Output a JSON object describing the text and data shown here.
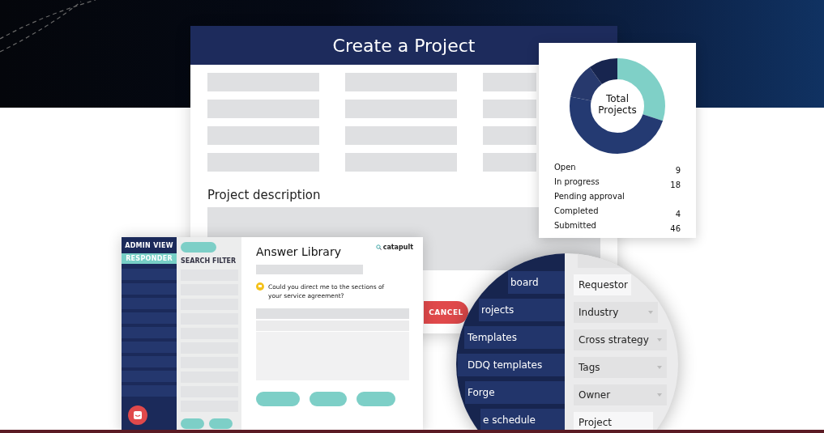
{
  "create_project": {
    "title": "Create a Project",
    "description_label": "Project description",
    "cancel_button": "CANCEL"
  },
  "stats": {
    "center_label": "Total Projects",
    "items": [
      {
        "label": "Open",
        "value": "9"
      },
      {
        "label": "In progress",
        "value": "18"
      },
      {
        "label": "Pending approval"
      },
      {
        "label": "Completed",
        "value": "4"
      },
      {
        "label": "Submitted",
        "value": "46"
      }
    ]
  },
  "answer_library": {
    "nav": [
      {
        "label": "ADMIN VIEW",
        "selected": false
      },
      {
        "label": "RESPONDER",
        "selected": true
      }
    ],
    "filter_label": "SEARCH FILTER",
    "title": "Answer Library",
    "brand": "catapult",
    "question": "Could you direct me to the sections of your service agreement?"
  },
  "magnifier": {
    "nav_items": [
      "board",
      "rojects",
      "Templates",
      "DDQ templates",
      "Forge",
      "e schedule"
    ],
    "fields": [
      {
        "label": "Requestor",
        "dropdown": false
      },
      {
        "label": "Industry",
        "dropdown": true
      },
      {
        "label": "Cross strategy",
        "dropdown": true
      },
      {
        "label": "Tags",
        "dropdown": true
      },
      {
        "label": "Owner",
        "dropdown": true
      },
      {
        "label": "Project",
        "dropdown": false
      }
    ]
  }
}
